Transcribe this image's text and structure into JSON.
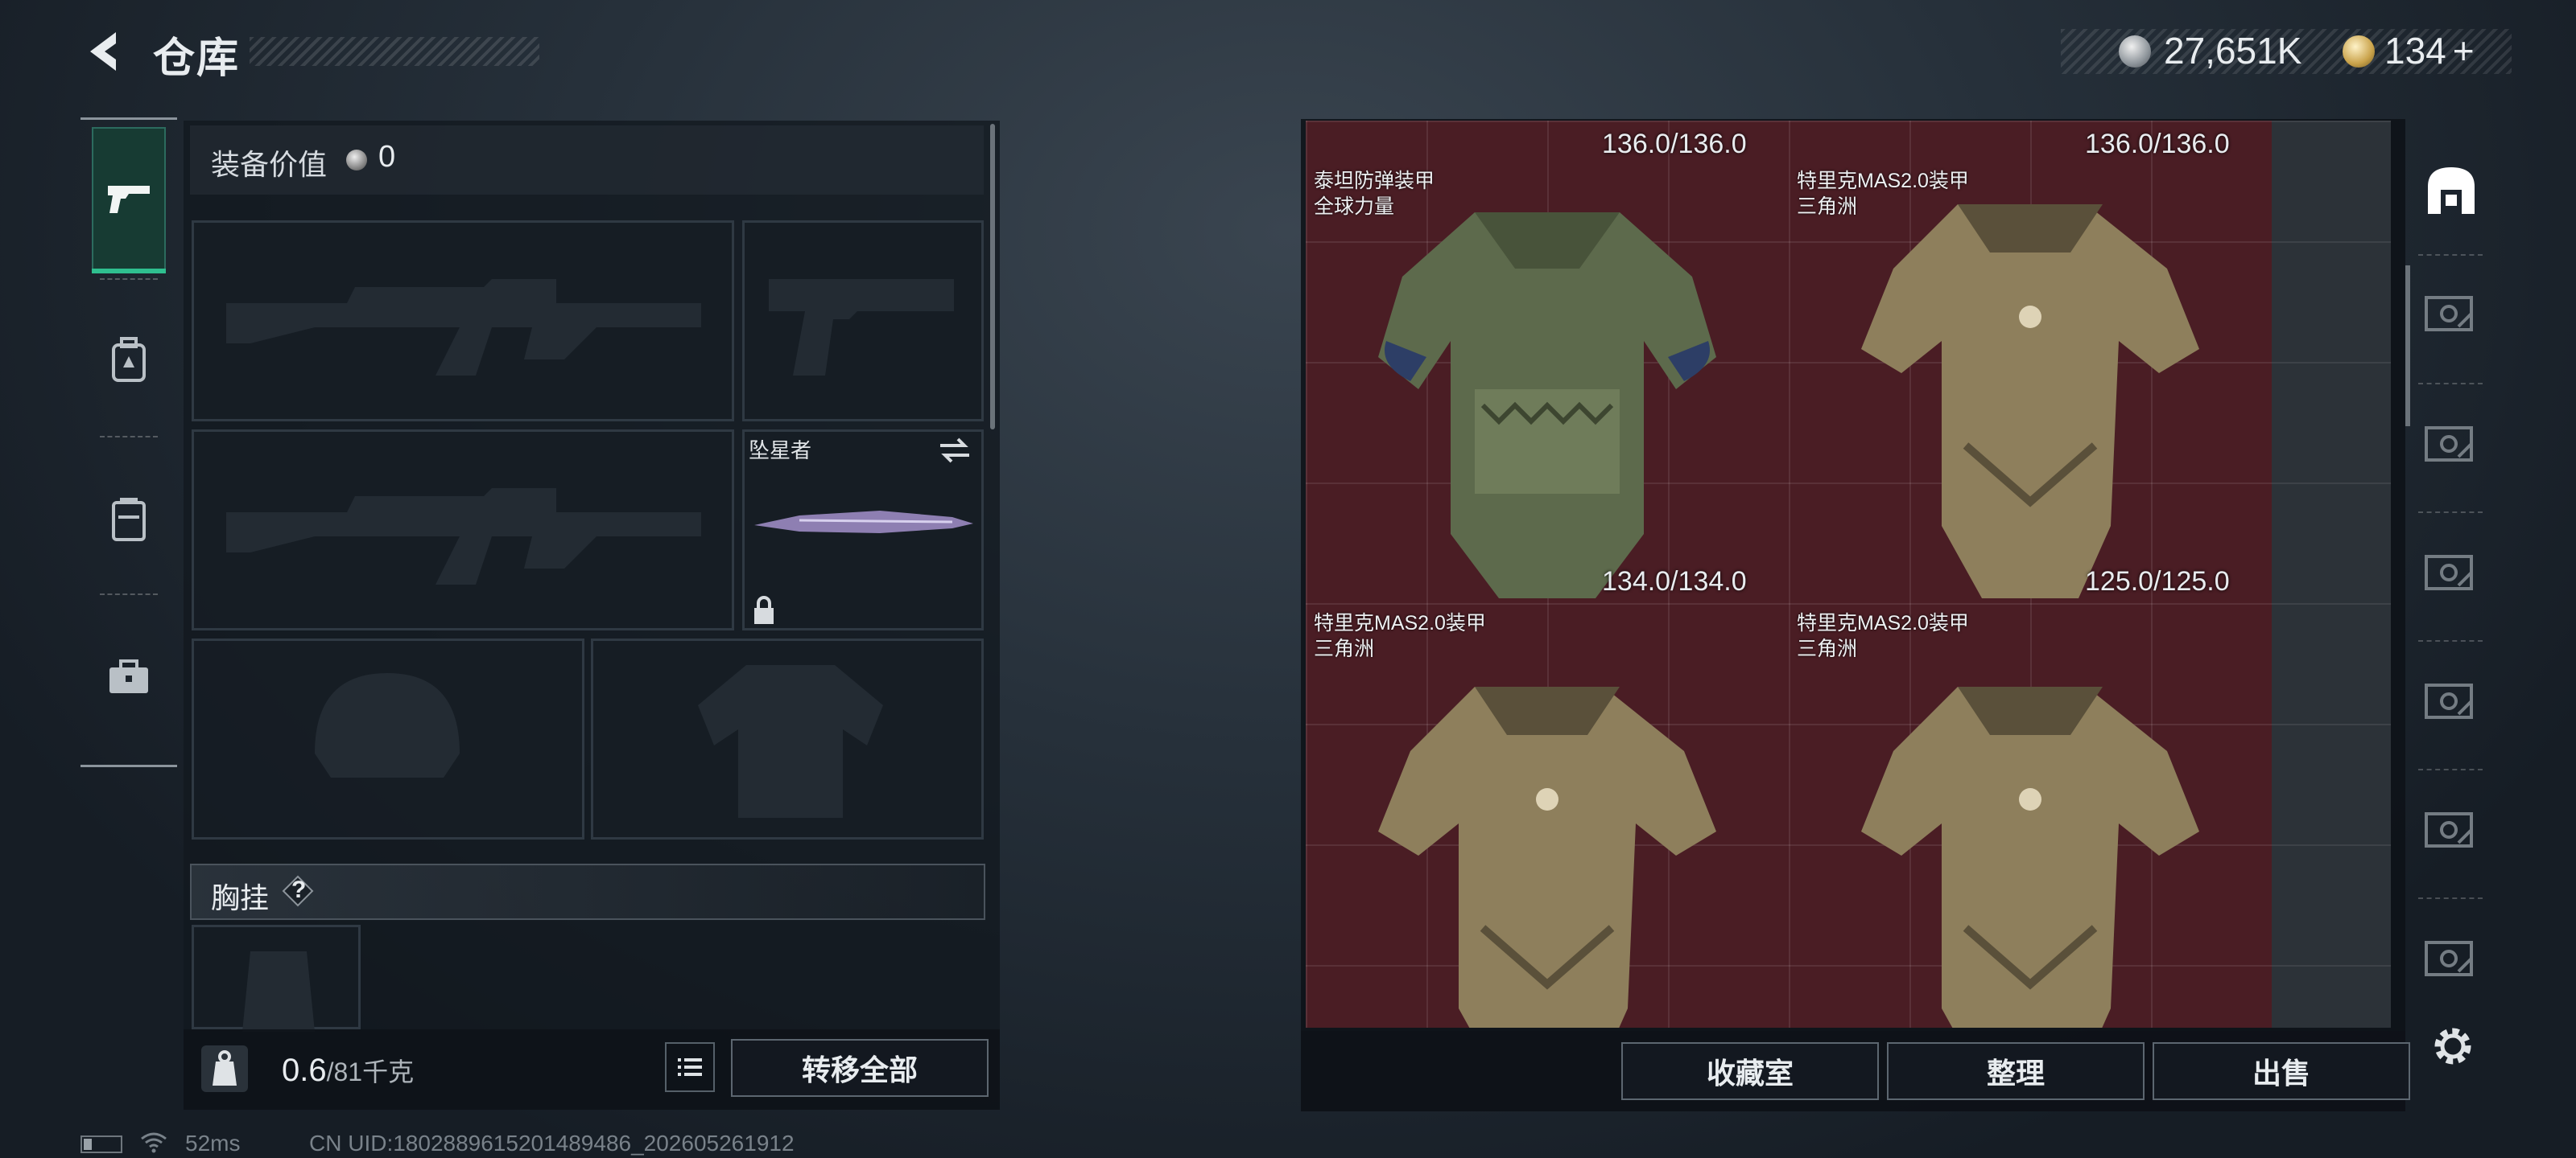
{
  "header": {
    "title": "仓库",
    "back_icon": "back-arrow-icon"
  },
  "currency": {
    "silver": "27,651K",
    "gold": "134",
    "gold_add": "+"
  },
  "tabs": [
    {
      "icon": "pistol-icon",
      "active": true
    },
    {
      "icon": "backpack-icon",
      "active": false
    },
    {
      "icon": "chest-rig-icon",
      "active": false
    },
    {
      "icon": "briefcase-icon",
      "active": false
    }
  ],
  "loadout": {
    "equip_value_label": "装备价值",
    "equip_value": "0",
    "melee_name": "坠星者",
    "chest_label": "胸挂",
    "chest_help": "?",
    "weight_current": "0.6",
    "weight_total": "/81千克",
    "transfer_all": "转移全部"
  },
  "warehouse": {
    "top_row": [
      {
        "durability": "136.0/136.0"
      },
      {
        "durability": "136.0/136.0"
      }
    ],
    "items": [
      {
        "name": "泰坦防弹装甲",
        "sub": "全球力量",
        "durability": "134.0/134.0",
        "color": "#5d6a4c"
      },
      {
        "name": "特里克MAS2.0装甲",
        "sub": "三角洲",
        "durability": "125.0/125.0",
        "color": "#8e7f5c"
      },
      {
        "name": "特里克MAS2.0装甲",
        "sub": "三角洲",
        "durability": "",
        "color": "#8e7f5c"
      },
      {
        "name": "特里克MAS2.0装甲",
        "sub": "三角洲",
        "durability": "",
        "color": "#8e7f5c"
      }
    ],
    "grid_bg": "#4a1d24"
  },
  "buttons": {
    "collection": "收藏室",
    "sort": "整理",
    "sell": "出售"
  },
  "status": {
    "ping": "52ms",
    "uid": "CN UID:1802889615201489486_202605261912"
  },
  "rail_icons": [
    "warehouse-home-icon",
    "vault-icon",
    "vault-icon",
    "vault-icon",
    "vault-icon",
    "vault-icon",
    "vault-icon"
  ]
}
